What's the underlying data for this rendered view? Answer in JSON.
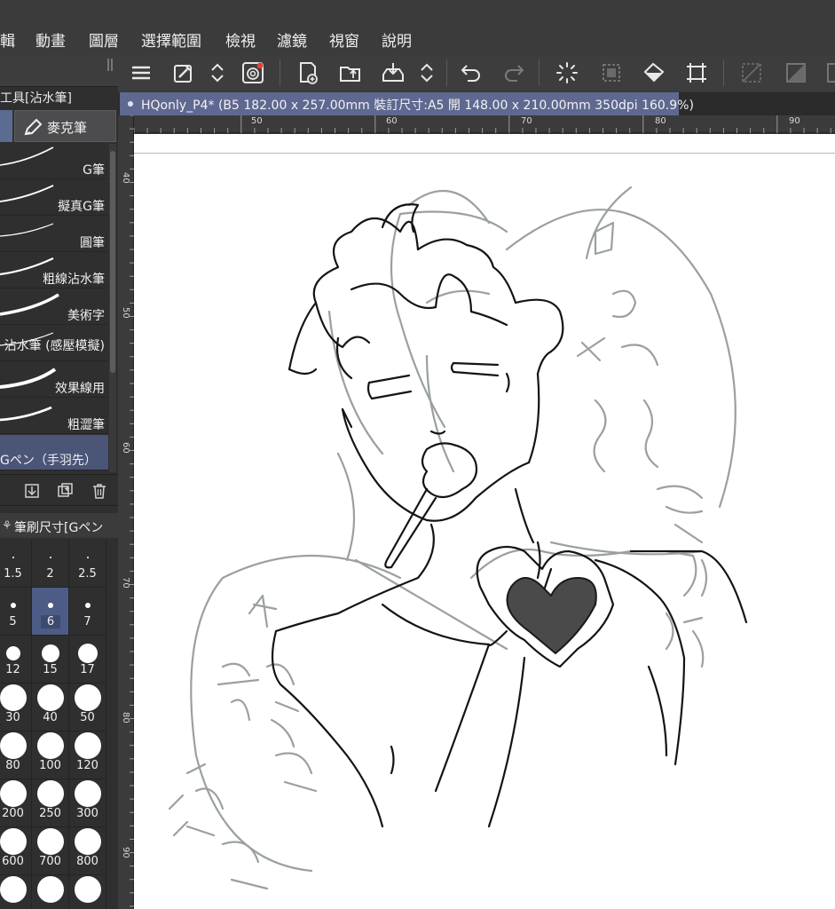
{
  "menubar": {
    "items": [
      "輯",
      "動畫",
      "圖層",
      "選擇範圍",
      "檢視",
      "濾鏡",
      "視窗",
      "說明"
    ]
  },
  "left_panel": {
    "subtool_title": "副工具[沾水筆]",
    "tab_label": "麥克筆",
    "brushes": [
      {
        "label": "G筆",
        "selected": false
      },
      {
        "label": "擬真G筆",
        "selected": false
      },
      {
        "label": "圓筆",
        "selected": false
      },
      {
        "label": "粗線沾水筆",
        "selected": false
      },
      {
        "label": "美術字",
        "selected": false
      },
      {
        "label": "沾水筆 (感壓模擬)",
        "selected": false
      },
      {
        "label": "效果線用",
        "selected": false
      },
      {
        "label": "粗澀筆",
        "selected": false
      },
      {
        "label": "Gペン（手羽先）",
        "selected": true
      }
    ],
    "actions": [
      "download-icon",
      "duplicate-icon",
      "trash-icon"
    ],
    "brush_size_title": "筆刷尺寸[Gペン",
    "sizes": [
      "1.5",
      "2",
      "2.5",
      "5",
      "6",
      "7",
      "12",
      "15",
      "17",
      "30",
      "40",
      "50",
      "80",
      "100",
      "120",
      "200",
      "250",
      "300",
      "600",
      "700",
      "800",
      "",
      "",
      ""
    ],
    "selected_size": "6"
  },
  "toolbar": {
    "icons": [
      "menu-icon",
      "eyedropper-icon",
      "up-down-icon",
      "target-icon",
      "new-page-icon",
      "open-folder-icon",
      "save-icon",
      "up-down-icon",
      "undo-icon",
      "redo-icon",
      "loading-icon",
      "clear-selection-icon",
      "fill-icon",
      "transform-icon",
      "deselect-icon",
      "invert-icon"
    ]
  },
  "document": {
    "tab_title": "HQonly_P4* (B5 182.00 x 257.00mm 裝訂尺寸:A5 開 148.00 x 210.00mm 350dpi 160.9%)"
  },
  "rulers": {
    "horizontal": [
      "50",
      "60",
      "70",
      "80",
      "90"
    ],
    "vertical": [
      "40",
      "50",
      "60",
      "70",
      "80",
      "90"
    ]
  },
  "colors": {
    "accent": "#5f6890",
    "selected_cell": "#4d5c86",
    "panel_bg": "#2f2f30",
    "toolbar_bg": "#3d3d3e"
  }
}
